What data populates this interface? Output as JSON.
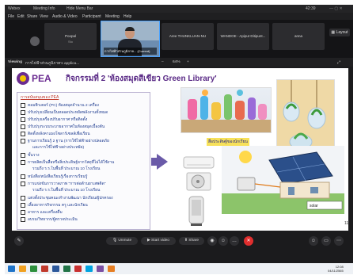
{
  "app": {
    "title_left": "Webex",
    "title_meeting": "Meeting Info",
    "title_hide": "Hide Menu Bar",
    "title_time": "42:39"
  },
  "menu": [
    "File",
    "Edit",
    "Share",
    "View",
    "Audio & Video",
    "Participant",
    "Meeting",
    "Help"
  ],
  "participants": [
    {
      "name": "Poopal",
      "sub": "Sto"
    },
    {
      "name": "Aree THUNKLUAN-NU",
      "sub": ""
    },
    {
      "name": "WANDOE - Apiput Ditipunt...",
      "sub": ""
    },
    {
      "name": "anna",
      "sub": ""
    }
  ],
  "active_speaker": {
    "label": "การไฟฟ้าส่วนภูมิภาค... (Current)"
  },
  "layout_button": "Layout",
  "viewing": {
    "label": "Viewing",
    "name": "การไฟฟ้าส่วนภูมิภาค's applica...",
    "zoom": "64%"
  },
  "slide": {
    "logo": "PEA",
    "title": "กิจกรรมที่ 2 'ห้องสมุดสีเขียว Green Library'",
    "list_header": "การสนับสนุนของ PEA",
    "items": [
      {
        "text": "คอมพิวเตอร์ (PC) ห้องสมุดจำนวน 2 เครื่อง",
        "cont": false
      },
      {
        "text": "ปรับปรุงเปลี่ยนเป็นหลอดประหยัดพลังงานทั้งหมด",
        "cont": false
      },
      {
        "text": "ปรับปรุงเครื่องปรับอากาศ หรือติดตั้ง",
        "cont": false
      },
      {
        "text": "ปรับปรุงระบบระบายอากาศในห้องสมุดเบื้องต้น",
        "cont": false
      },
      {
        "text": "ติดตั้งหลังคาแผงโซลาร์เซลล์เพื่อเรียน",
        "cont": false
      },
      {
        "text": "ฐานการเรียนรู้ 2 ฐาน (การใช้ไฟฟ้าอย่างปลอดภัย",
        "cont": false
      },
      {
        "text": "และการใช้ไฟฟ้าอย่างประหยัด)",
        "cont": true
      },
      {
        "text": "ชั้นวาง",
        "cont": false
      },
      {
        "text": "การผลิตเป็นสื่อหรือสิ่งประดิษฐ์จากวัสดุที่ไม่ได้ใช้งาน",
        "cont": false
      },
      {
        "text": "รวมถึง ร.ร.ในพื้นที่ ประมาณ 10 โรงเรียน",
        "cont": true
      },
      {
        "text": "หนังสือ/หนังสือเรียนรู้เรื่องการเรียนรู้",
        "cont": false
      },
      {
        "text": "การแข่งขันการวาดภาพ \"การต่อต้านยาเสพติด\"",
        "cont": false
      },
      {
        "text": "รวมถึง ร.ร.ในพื้นที่ ประมาณ 10 โรงเรียน",
        "cont": true
      },
      {
        "text": "แต่งตั้งประชุมคณะทำงานพัฒนา นักเรียน/ผู้ปกครอง",
        "cont": false
      },
      {
        "text": "เลี้ยงอาหารกิจกรรม ครู และนักเรียน",
        "cont": false
      },
      {
        "text": "อาหาร และเครื่องดื่ม",
        "cont": false
      },
      {
        "text": "อบรม/วิทยากร/ผู้ตรวจประเมิน",
        "cont": false
      }
    ],
    "caption": "สื่อประดิษฐ์ของนักเรียน",
    "page_number": "11"
  },
  "controls": {
    "unmute": "Unmute",
    "start_video": "Start video",
    "share": "Share"
  },
  "taskbar": {
    "time": "12:08",
    "date": "04/11/2565"
  },
  "colors": {
    "accent": "#4aa3ff",
    "pea_purple": "#6b2c91",
    "end_red": "#e02e2e"
  }
}
